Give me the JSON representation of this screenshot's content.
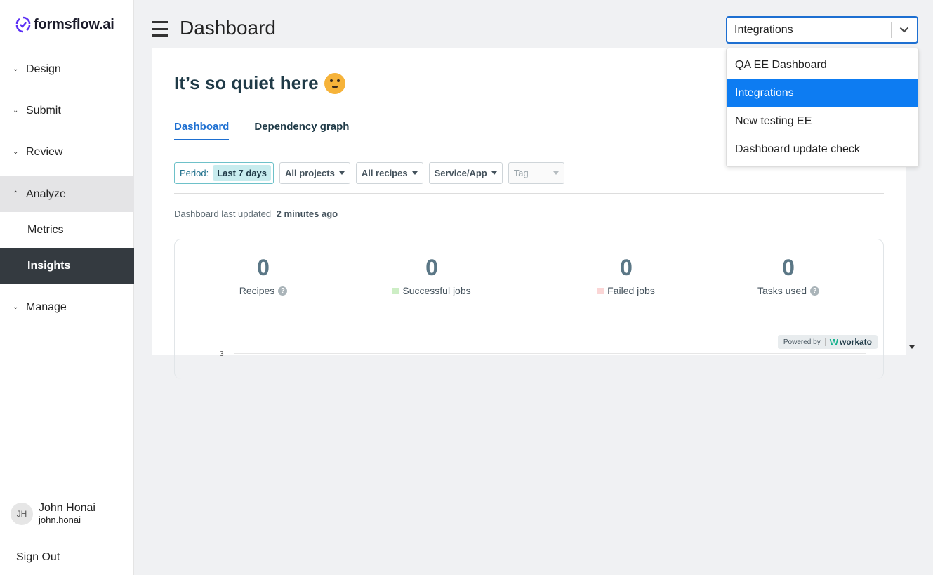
{
  "brand": {
    "name": "formsflow.ai",
    "accent": "#5b2ff5"
  },
  "sidebar": {
    "items": [
      {
        "label": "Design",
        "chevron": "⌄"
      },
      {
        "label": "Submit",
        "chevron": "⌄"
      },
      {
        "label": "Review",
        "chevron": "⌄"
      },
      {
        "label": "Analyze",
        "chevron": "⌃"
      },
      {
        "label": "Manage",
        "chevron": "⌄"
      }
    ],
    "sub_items": [
      {
        "label": "Metrics"
      },
      {
        "label": "Insights"
      }
    ],
    "user": {
      "initials": "JH",
      "name": "John Honai",
      "handle": "john.honai"
    },
    "sign_out": "Sign Out"
  },
  "header": {
    "title": "Dashboard"
  },
  "dashboard_select": {
    "value": "Integrations",
    "options": [
      "QA EE Dashboard",
      "Integrations",
      "New testing EE",
      "Dashboard update check"
    ],
    "selected_index": 1
  },
  "main": {
    "title": "It’s so quiet here",
    "tabs": [
      {
        "label": "Dashboard"
      },
      {
        "label": "Dependency graph"
      }
    ],
    "filters": {
      "period_label": "Period:",
      "period_value": "Last 7 days",
      "projects": "All projects",
      "recipes": "All recipes",
      "service": "Service/App",
      "tag": "Tag"
    },
    "updated_label": "Dashboard last updated",
    "updated_value": "2 minutes ago",
    "stats": [
      {
        "value": "0",
        "label": "Recipes",
        "help": "?"
      },
      {
        "value": "0",
        "label": "Successful jobs",
        "swatch": "#cdeec5"
      },
      {
        "value": "0",
        "label": "Failed jobs",
        "swatch": "#fbd6d6"
      },
      {
        "value": "0",
        "label": "Tasks used",
        "help": "?"
      }
    ],
    "powered_by": "Powered by",
    "workato": "workato",
    "axis_tick": "3"
  }
}
